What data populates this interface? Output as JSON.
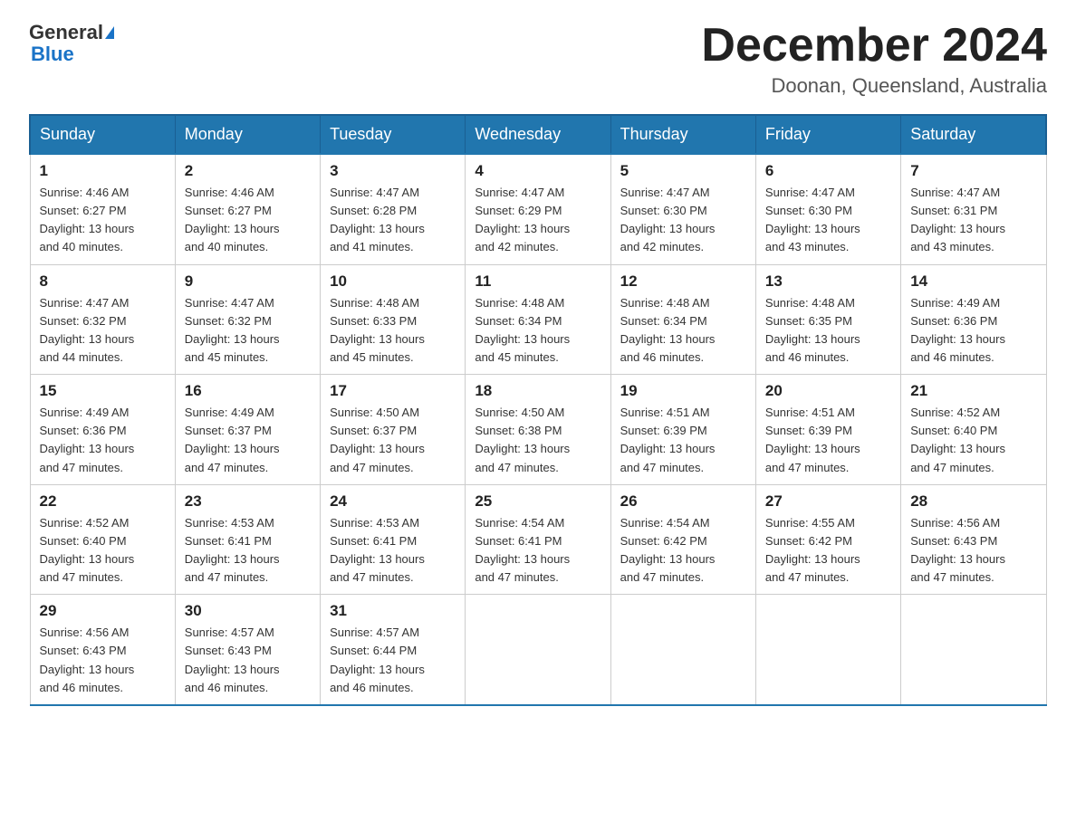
{
  "header": {
    "logo_general": "General",
    "logo_blue": "Blue",
    "month_title": "December 2024",
    "location": "Doonan, Queensland, Australia"
  },
  "days_of_week": [
    "Sunday",
    "Monday",
    "Tuesday",
    "Wednesday",
    "Thursday",
    "Friday",
    "Saturday"
  ],
  "weeks": [
    [
      {
        "day": "1",
        "sunrise": "4:46 AM",
        "sunset": "6:27 PM",
        "daylight": "13 hours and 40 minutes."
      },
      {
        "day": "2",
        "sunrise": "4:46 AM",
        "sunset": "6:27 PM",
        "daylight": "13 hours and 40 minutes."
      },
      {
        "day": "3",
        "sunrise": "4:47 AM",
        "sunset": "6:28 PM",
        "daylight": "13 hours and 41 minutes."
      },
      {
        "day": "4",
        "sunrise": "4:47 AM",
        "sunset": "6:29 PM",
        "daylight": "13 hours and 42 minutes."
      },
      {
        "day": "5",
        "sunrise": "4:47 AM",
        "sunset": "6:30 PM",
        "daylight": "13 hours and 42 minutes."
      },
      {
        "day": "6",
        "sunrise": "4:47 AM",
        "sunset": "6:30 PM",
        "daylight": "13 hours and 43 minutes."
      },
      {
        "day": "7",
        "sunrise": "4:47 AM",
        "sunset": "6:31 PM",
        "daylight": "13 hours and 43 minutes."
      }
    ],
    [
      {
        "day": "8",
        "sunrise": "4:47 AM",
        "sunset": "6:32 PM",
        "daylight": "13 hours and 44 minutes."
      },
      {
        "day": "9",
        "sunrise": "4:47 AM",
        "sunset": "6:32 PM",
        "daylight": "13 hours and 45 minutes."
      },
      {
        "day": "10",
        "sunrise": "4:48 AM",
        "sunset": "6:33 PM",
        "daylight": "13 hours and 45 minutes."
      },
      {
        "day": "11",
        "sunrise": "4:48 AM",
        "sunset": "6:34 PM",
        "daylight": "13 hours and 45 minutes."
      },
      {
        "day": "12",
        "sunrise": "4:48 AM",
        "sunset": "6:34 PM",
        "daylight": "13 hours and 46 minutes."
      },
      {
        "day": "13",
        "sunrise": "4:48 AM",
        "sunset": "6:35 PM",
        "daylight": "13 hours and 46 minutes."
      },
      {
        "day": "14",
        "sunrise": "4:49 AM",
        "sunset": "6:36 PM",
        "daylight": "13 hours and 46 minutes."
      }
    ],
    [
      {
        "day": "15",
        "sunrise": "4:49 AM",
        "sunset": "6:36 PM",
        "daylight": "13 hours and 47 minutes."
      },
      {
        "day": "16",
        "sunrise": "4:49 AM",
        "sunset": "6:37 PM",
        "daylight": "13 hours and 47 minutes."
      },
      {
        "day": "17",
        "sunrise": "4:50 AM",
        "sunset": "6:37 PM",
        "daylight": "13 hours and 47 minutes."
      },
      {
        "day": "18",
        "sunrise": "4:50 AM",
        "sunset": "6:38 PM",
        "daylight": "13 hours and 47 minutes."
      },
      {
        "day": "19",
        "sunrise": "4:51 AM",
        "sunset": "6:39 PM",
        "daylight": "13 hours and 47 minutes."
      },
      {
        "day": "20",
        "sunrise": "4:51 AM",
        "sunset": "6:39 PM",
        "daylight": "13 hours and 47 minutes."
      },
      {
        "day": "21",
        "sunrise": "4:52 AM",
        "sunset": "6:40 PM",
        "daylight": "13 hours and 47 minutes."
      }
    ],
    [
      {
        "day": "22",
        "sunrise": "4:52 AM",
        "sunset": "6:40 PM",
        "daylight": "13 hours and 47 minutes."
      },
      {
        "day": "23",
        "sunrise": "4:53 AM",
        "sunset": "6:41 PM",
        "daylight": "13 hours and 47 minutes."
      },
      {
        "day": "24",
        "sunrise": "4:53 AM",
        "sunset": "6:41 PM",
        "daylight": "13 hours and 47 minutes."
      },
      {
        "day": "25",
        "sunrise": "4:54 AM",
        "sunset": "6:41 PM",
        "daylight": "13 hours and 47 minutes."
      },
      {
        "day": "26",
        "sunrise": "4:54 AM",
        "sunset": "6:42 PM",
        "daylight": "13 hours and 47 minutes."
      },
      {
        "day": "27",
        "sunrise": "4:55 AM",
        "sunset": "6:42 PM",
        "daylight": "13 hours and 47 minutes."
      },
      {
        "day": "28",
        "sunrise": "4:56 AM",
        "sunset": "6:43 PM",
        "daylight": "13 hours and 47 minutes."
      }
    ],
    [
      {
        "day": "29",
        "sunrise": "4:56 AM",
        "sunset": "6:43 PM",
        "daylight": "13 hours and 46 minutes."
      },
      {
        "day": "30",
        "sunrise": "4:57 AM",
        "sunset": "6:43 PM",
        "daylight": "13 hours and 46 minutes."
      },
      {
        "day": "31",
        "sunrise": "4:57 AM",
        "sunset": "6:44 PM",
        "daylight": "13 hours and 46 minutes."
      },
      null,
      null,
      null,
      null
    ]
  ],
  "labels": {
    "sunrise": "Sunrise:",
    "sunset": "Sunset:",
    "daylight": "Daylight:"
  }
}
